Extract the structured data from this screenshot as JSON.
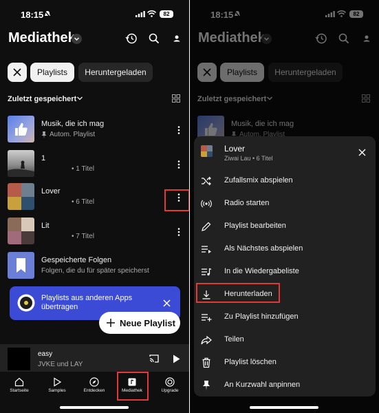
{
  "status": {
    "time": "18:15",
    "battery": "82"
  },
  "header": {
    "title": "Mediathek"
  },
  "chips": {
    "playlists": "Playlists",
    "downloaded": "Heruntergeladen"
  },
  "sort": {
    "label": "Zuletzt gespeichert"
  },
  "items": [
    {
      "title": "Musik, die ich mag",
      "subtitle": "Autom. Playlist"
    },
    {
      "title": "1",
      "subtitle": "• 1 Titel"
    },
    {
      "title": "Lover",
      "subtitle": "• 6 Titel"
    },
    {
      "title": "Lit",
      "subtitle": "• 7 Titel"
    },
    {
      "title": "Gespeicherte Folgen",
      "subtitle": "Folgen, die du für später speicherst"
    }
  ],
  "banner": {
    "text": "Playlists aus anderen Apps übertragen"
  },
  "new_playlist": {
    "label": "Neue Playlist"
  },
  "mini_player": {
    "title": "easy",
    "artist": "JVKE und LAY"
  },
  "nav": [
    {
      "label": "Startseite",
      "icon": "home-icon"
    },
    {
      "label": "Samples",
      "icon": "samples-icon"
    },
    {
      "label": "Entdecken",
      "icon": "compass-icon"
    },
    {
      "label": "Mediathek",
      "icon": "library-icon"
    },
    {
      "label": "Upgrade",
      "icon": "upgrade-icon"
    }
  ],
  "menu": {
    "title": "Lover",
    "subtitle": "Ziwai Lau • 6 Titel",
    "items": [
      {
        "label": "Zufallsmix abspielen",
        "icon": "shuffle-icon"
      },
      {
        "label": "Radio starten",
        "icon": "radio-icon"
      },
      {
        "label": "Playlist bearbeiten",
        "icon": "pencil-icon"
      },
      {
        "label": "Als Nächstes abspielen",
        "icon": "play-next-icon"
      },
      {
        "label": "In die Wiedergabeliste",
        "icon": "queue-icon"
      },
      {
        "label": "Herunterladen",
        "icon": "download-icon"
      },
      {
        "label": "Zu Playlist hinzufügen",
        "icon": "playlist-add-icon"
      },
      {
        "label": "Teilen",
        "icon": "share-icon"
      },
      {
        "label": "Playlist löschen",
        "icon": "trash-icon"
      },
      {
        "label": "An Kurzwahl anpinnen",
        "icon": "pin-icon"
      }
    ]
  },
  "colors": {
    "background": "#0f0f0f",
    "highlight": "#e53935",
    "banner": "#3c4bd6",
    "sheet": "#212121"
  }
}
